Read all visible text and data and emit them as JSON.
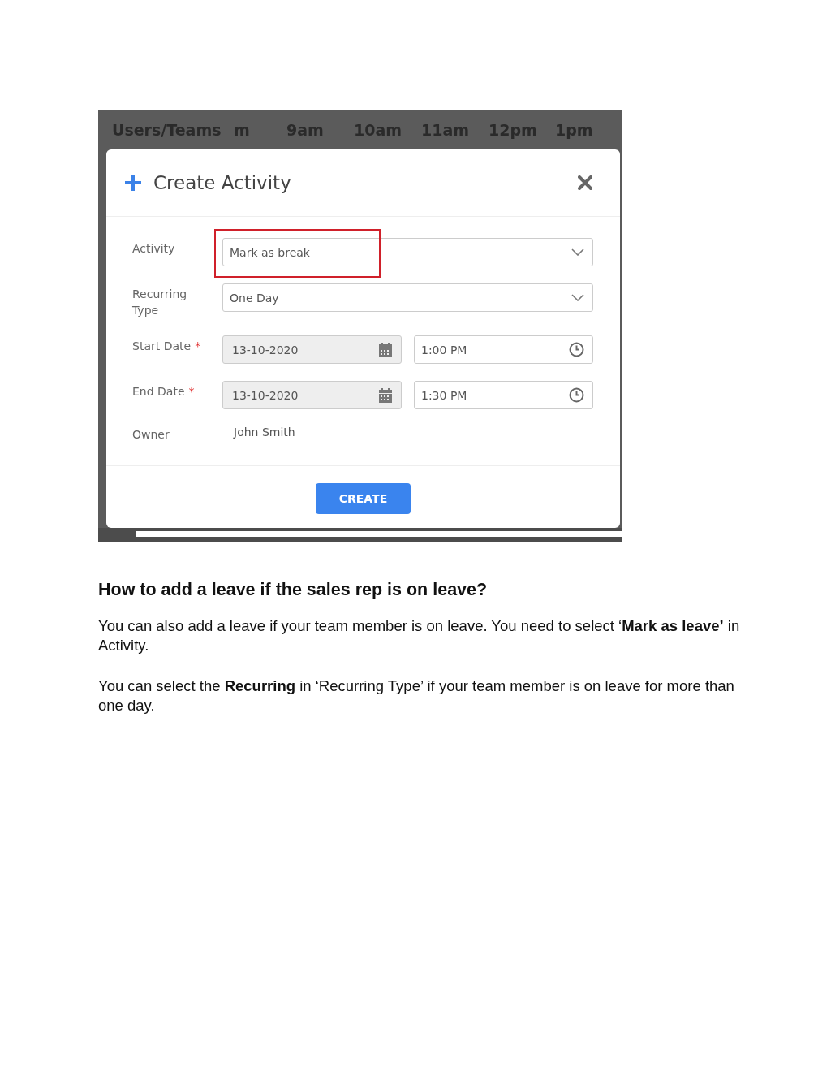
{
  "schedule_header": {
    "columns": [
      "Users/Teams",
      "m",
      "9am",
      "10am",
      "11am",
      "12pm",
      "1pm"
    ]
  },
  "dialog": {
    "title": "Create Activity",
    "fields": [
      {
        "kind": "select",
        "label": "Activity",
        "value": "Mark as break",
        "highlighted": true
      },
      {
        "kind": "select",
        "label": "Recurring Type",
        "value": "One Day",
        "highlighted": false
      },
      {
        "kind": "datetime",
        "label": "Start Date",
        "required_mark": "*",
        "date": "13-10-2020",
        "time": "1:00 PM"
      },
      {
        "kind": "datetime",
        "label": "End Date",
        "required_mark": "*",
        "date": "13-10-2020",
        "time": "1:30 PM"
      },
      {
        "kind": "static",
        "label": "Owner",
        "value": "John Smith"
      }
    ],
    "button": "CREATE"
  },
  "article": {
    "heading": "How to add a leave if the sales rep is on leave?",
    "paragraphs": [
      "You can also add a leave if your team member is on leave. You need to select ‘**Mark as leave’** in Activity.",
      "You can select the **Recurring** in ‘Recurring Type’ if your team member is on leave for more than one day."
    ]
  }
}
